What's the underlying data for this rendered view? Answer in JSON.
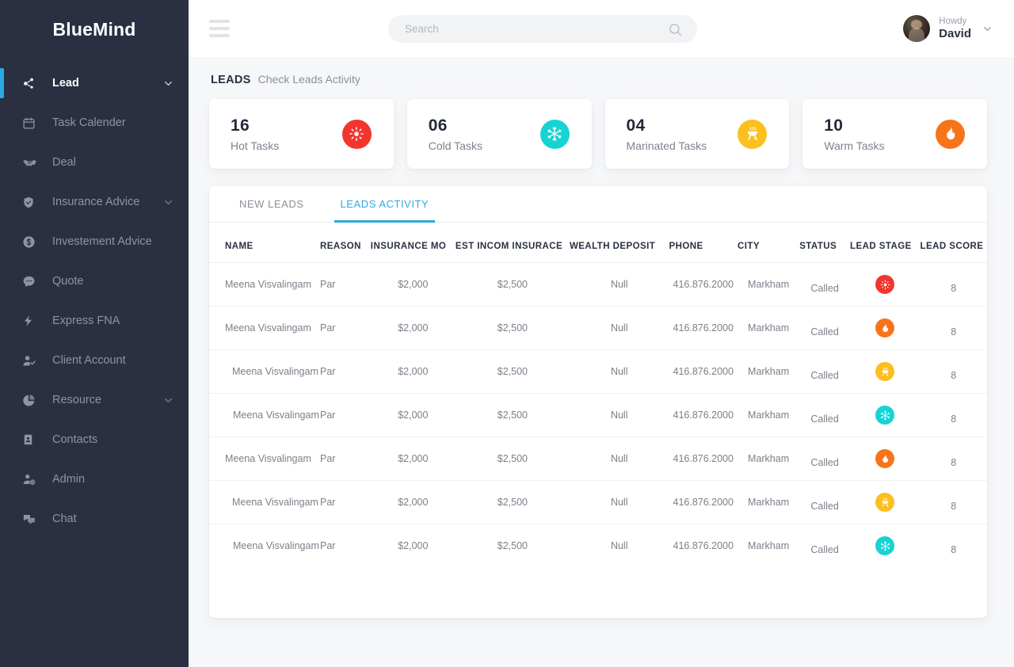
{
  "brand": {
    "name": "BlueMind"
  },
  "colors": {
    "sidebar_bg": "#2a3042",
    "accent_blue": "#29abe2",
    "tab_active": "#2fa8dd",
    "hot": "#f2352f",
    "cold": "#17d3d3",
    "marinated": "#fcbf1e",
    "warm": "#f8741a",
    "content_bg": "#f6f7f9"
  },
  "sidebar": {
    "items": [
      {
        "label": "Lead",
        "icon": "share-nodes-icon",
        "active": true,
        "caret": true
      },
      {
        "label": "Task Calender",
        "icon": "calendar-icon",
        "active": false,
        "caret": false
      },
      {
        "label": "Deal",
        "icon": "handshake-icon",
        "active": false,
        "caret": false
      },
      {
        "label": "Insurance Advice",
        "icon": "shield-check-icon",
        "active": false,
        "caret": true
      },
      {
        "label": "Investement Advice",
        "icon": "dollar-circle-icon",
        "active": false,
        "caret": false
      },
      {
        "label": "Quote",
        "icon": "chat-bubble-icon",
        "active": false,
        "caret": false
      },
      {
        "label": "Express FNA",
        "icon": "lightning-bolt-icon",
        "active": false,
        "caret": false
      },
      {
        "label": "Client Account",
        "icon": "user-check-icon",
        "active": false,
        "caret": false
      },
      {
        "label": "Resource",
        "icon": "pie-chart-icon",
        "active": false,
        "caret": true
      },
      {
        "label": "Contacts",
        "icon": "contact-card-icon",
        "active": false,
        "caret": false
      },
      {
        "label": "Admin",
        "icon": "user-gear-icon",
        "active": false,
        "caret": false
      },
      {
        "label": "Chat",
        "icon": "chat-double-icon",
        "active": false,
        "caret": false
      }
    ]
  },
  "topbar": {
    "menu_icon": "hamburger-icon",
    "search": {
      "value": "",
      "placeholder": "Search",
      "icon": "search-icon"
    },
    "user": {
      "greeting": "Howdy",
      "name": "David",
      "caret_icon": "chevron-down-icon",
      "avatar": "user-avatar"
    }
  },
  "page": {
    "title": "LEADS",
    "subtitle": "Check Leads Activity"
  },
  "stat_cards": [
    {
      "value": "16",
      "label": "Hot Tasks",
      "icon": "sun-icon",
      "theme": "hot"
    },
    {
      "value": "06",
      "label": "Cold Tasks",
      "icon": "snowflake-icon",
      "theme": "cold"
    },
    {
      "value": "04",
      "label": "Marinated Tasks",
      "icon": "grill-icon",
      "theme": "marinated"
    },
    {
      "value": "10",
      "label": "Warm Tasks",
      "icon": "flame-icon",
      "theme": "warm"
    }
  ],
  "tabs": [
    {
      "label": "NEW LEADS",
      "active": false
    },
    {
      "label": "LEADS ACTIVITY",
      "active": true
    }
  ],
  "table": {
    "columns": [
      "NAME",
      "REASON",
      "INSURANCE MO",
      "EST INCOM INSURACE",
      "WEALTH DEPOSIT",
      "PHONE",
      "CITY",
      "STATUS",
      "LEAD STAGE",
      "LEAD SCORE"
    ],
    "rows": [
      {
        "name": "Meena Visvalingam",
        "reason": "Par",
        "insurance_mo": "$2,000",
        "est_incom_insurace": "$2,500",
        "wealth_deposit": "Null",
        "phone": "416.876.2000",
        "city": "Markham",
        "status": "Called",
        "lead_stage": "hot",
        "lead_stage_icon": "sun-icon",
        "lead_score": "8"
      },
      {
        "name": "Meena Visvalingam",
        "reason": "Par",
        "insurance_mo": "$2,000",
        "est_incom_insurace": "$2,500",
        "wealth_deposit": "Null",
        "phone": "416.876.2000",
        "city": "Markham",
        "status": "Called",
        "lead_stage": "warm",
        "lead_stage_icon": "flame-icon",
        "lead_score": "8"
      },
      {
        "name": "Meena Visvalingam",
        "reason": "Par",
        "insurance_mo": "$2,000",
        "est_incom_insurace": "$2,500",
        "wealth_deposit": "Null",
        "phone": "416.876.2000",
        "city": "Markham",
        "status": "Called",
        "lead_stage": "marinated",
        "lead_stage_icon": "grill-icon",
        "lead_score": "8"
      },
      {
        "name": "Meena Visvalingam",
        "reason": "Par",
        "insurance_mo": "$2,000",
        "est_incom_insurace": "$2,500",
        "wealth_deposit": "Null",
        "phone": "416.876.2000",
        "city": "Markham",
        "status": "Called",
        "lead_stage": "cold",
        "lead_stage_icon": "snowflake-icon",
        "lead_score": "8"
      },
      {
        "name": "Meena Visvalingam",
        "reason": "Par",
        "insurance_mo": "$2,000",
        "est_incom_insurace": "$2,500",
        "wealth_deposit": "Null",
        "phone": "416.876.2000",
        "city": "Markham",
        "status": "Called",
        "lead_stage": "warm",
        "lead_stage_icon": "flame-icon",
        "lead_score": "8"
      },
      {
        "name": "Meena Visvalingam",
        "reason": "Par",
        "insurance_mo": "$2,000",
        "est_incom_insurace": "$2,500",
        "wealth_deposit": "Null",
        "phone": "416.876.2000",
        "city": "Markham",
        "status": "Called",
        "lead_stage": "marinated",
        "lead_stage_icon": "grill-icon",
        "lead_score": "8"
      },
      {
        "name": "Meena Visvalingam",
        "reason": "Par",
        "insurance_mo": "$2,000",
        "est_incom_insurace": "$2,500",
        "wealth_deposit": "Null",
        "phone": "416.876.2000",
        "city": "Markham",
        "status": "Called",
        "lead_stage": "cold",
        "lead_stage_icon": "snowflake-icon",
        "lead_score": "8"
      }
    ]
  }
}
